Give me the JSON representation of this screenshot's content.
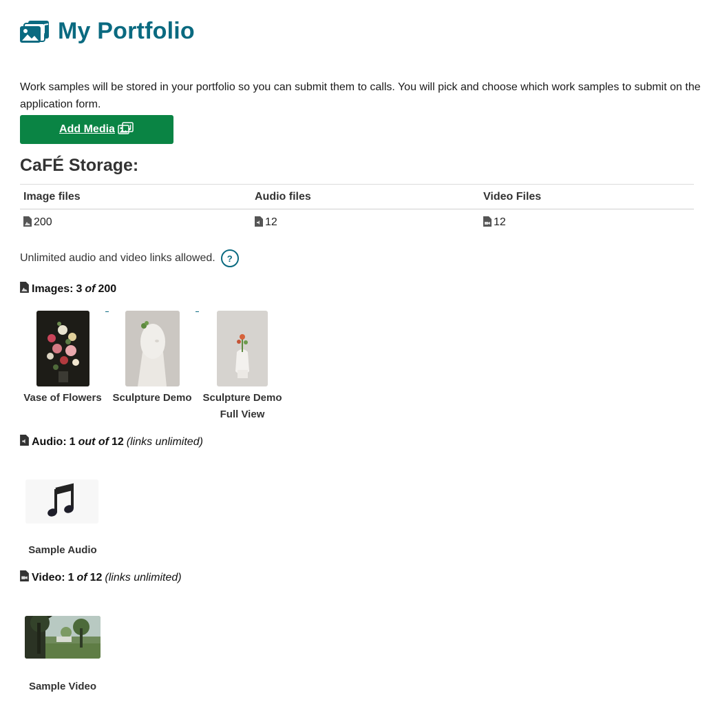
{
  "header": {
    "title": "My Portfolio",
    "icon": "media-collection-icon"
  },
  "intro": "Work samples will be stored in your portfolio so you can submit them to calls. You will pick and choose which work samples to submit on the application form.",
  "add_media": {
    "label": "Add Media",
    "icon": "media-collection-icon",
    "color": "#0a8444"
  },
  "storage": {
    "title": "CaFÉ Storage:",
    "columns": [
      "Image files",
      "Audio files",
      "Video Files"
    ],
    "values": [
      "200",
      "12",
      "12"
    ],
    "links_note": "Unlimited audio and video links allowed.",
    "help": "?"
  },
  "images": {
    "label": "Images:",
    "count": "3",
    "of": "of",
    "total": "200",
    "items": [
      {
        "title": "Vase of Flowers"
      },
      {
        "title": "Sculpture Demo"
      },
      {
        "title": "Sculpture Demo Full View"
      }
    ]
  },
  "audio": {
    "label": "Audio:",
    "count": "1",
    "of": "out of",
    "total": "12",
    "note": "(links unlimited)",
    "items": [
      {
        "title": "Sample Audio"
      }
    ]
  },
  "video": {
    "label": "Video:",
    "count": "1",
    "of": "of",
    "total": "12",
    "note": "(links unlimited)",
    "items": [
      {
        "title": "Sample Video"
      }
    ]
  },
  "colors": {
    "accent": "#0a6a80",
    "button": "#0a8444"
  }
}
